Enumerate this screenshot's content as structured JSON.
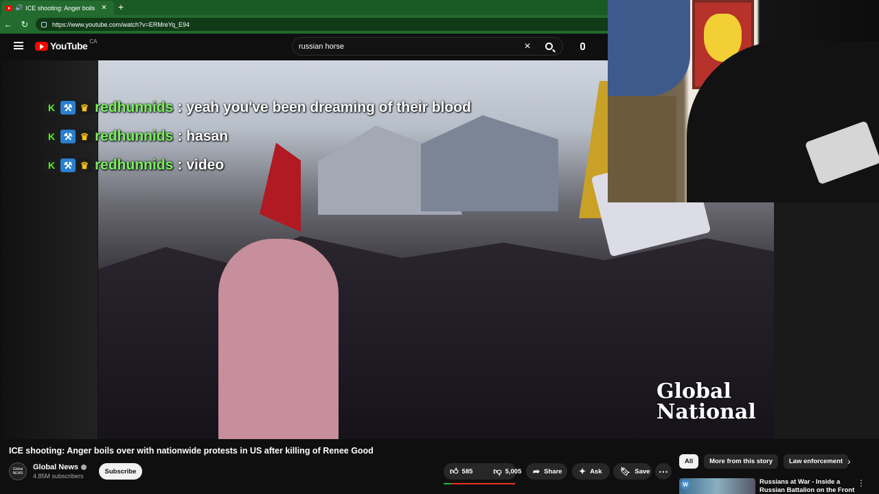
{
  "browser": {
    "tab_title": "ICE shooting: Anger boils over",
    "url": "https://www.youtube.com/watch?v=ERMreYq_E94"
  },
  "youtube": {
    "logo_text": "YouTube",
    "country_code": "CA",
    "search_query": "russian horse"
  },
  "chat": [
    {
      "user": "redhunnids",
      "message": "yeah you've been dreaming of their blood"
    },
    {
      "user": "redhunnids",
      "message": "hasan"
    },
    {
      "user": "redhunnids",
      "message": "video"
    }
  ],
  "video": {
    "watermark_line1": "Global",
    "watermark_line2": "National",
    "title": "ICE shooting: Anger boils over with nationwide protests in US after killing of Renee Good"
  },
  "channel": {
    "name": "Global News",
    "subscribers": "4.85M subscribers",
    "subscribe_label": "Subscribe",
    "avatar_text": "Global NEWS"
  },
  "actions": {
    "likes": "585",
    "dislikes": "5,005",
    "like_ratio": 0.105,
    "share_label": "Share",
    "ask_label": "Ask",
    "save_label": "Save"
  },
  "chips": [
    "All",
    "More from this story",
    "Law enforcement"
  ],
  "recommendation": {
    "title": "Russians at War - Inside a Russian Battalion on the Front",
    "badge": "W"
  }
}
